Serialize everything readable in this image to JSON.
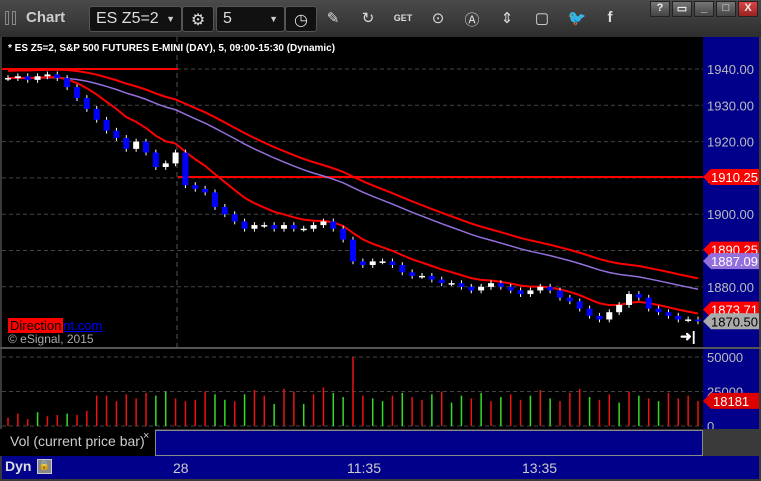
{
  "window": {
    "title": "Chart",
    "symbol": "ES Z5=2",
    "interval": "5",
    "buttons": [
      "?",
      "restore",
      "_",
      "□",
      "X"
    ]
  },
  "toolbar_icons": [
    "settings-icon",
    "clock-icon",
    "pencil-icon",
    "refresh-icon",
    "get-icon",
    "play-icon",
    "alert-icon",
    "link-icon",
    "chat-icon",
    "twitter-icon",
    "facebook-icon"
  ],
  "chart": {
    "header": "* ES Z5=2, S&P 500 FUTURES E-MINI (DAY), 5, 09:00-15:30 (Dynamic)",
    "watermark_label": "Direction",
    "watermark_link": "nt.com",
    "copyright": "© eSignal, 2015",
    "price_ticks": [
      "1940.00",
      "1930.00",
      "1920.00",
      "1910.00",
      "1900.00",
      "1890.00",
      "1880.00"
    ],
    "price_tick_values": [
      1940,
      1930,
      1920,
      1910,
      1900,
      1890,
      1880
    ],
    "price_labels": [
      {
        "text": "1910.25",
        "value": 1910.25,
        "color": "#ff0000"
      },
      {
        "text": "1890.25",
        "value": 1890.25,
        "color": "#ff0000"
      },
      {
        "text": "1887.09",
        "value": 1887.09,
        "color": "#9370db"
      },
      {
        "text": "1873.71",
        "value": 1873.71,
        "color": "#ff0000"
      },
      {
        "text": "1870.50",
        "value": 1870.5,
        "color": "#aaaaaa"
      }
    ],
    "prior_high": 1940,
    "prior_close": 1910.25,
    "open_close": 1937.5,
    "closes": [
      1937.5,
      1938,
      1937,
      1938,
      1938.5,
      1937.5,
      1935,
      1932,
      1929,
      1926,
      1923,
      1921,
      1918,
      1920,
      1917,
      1913,
      1914,
      1917,
      1908,
      1907,
      1906,
      1902,
      1900,
      1898,
      1896,
      1897,
      1897,
      1896,
      1897,
      1896,
      1896,
      1897,
      1898,
      1896,
      1893,
      1887,
      1886,
      1887,
      1887,
      1886,
      1884,
      1883,
      1883,
      1882,
      1881,
      1881,
      1880,
      1879,
      1880,
      1881,
      1880,
      1879,
      1878,
      1879,
      1880,
      1879,
      1877,
      1876,
      1874,
      1872,
      1871,
      1873,
      1875,
      1878,
      1877,
      1874,
      1873,
      1872,
      1871,
      1871,
      1870.5
    ],
    "volume_ticks": [
      "50000",
      "25000",
      "0"
    ],
    "volume_last": "18181",
    "volumes": [
      6000,
      9000,
      5000,
      10000,
      7000,
      8000,
      9000,
      8000,
      11000,
      22000,
      22000,
      18000,
      23000,
      20000,
      24000,
      22000,
      25000,
      20000,
      18000,
      19000,
      25000,
      23000,
      19000,
      18000,
      23000,
      26000,
      22000,
      16000,
      27000,
      25000,
      16000,
      23000,
      28000,
      24000,
      21000,
      50000,
      22000,
      20000,
      18000,
      22000,
      24000,
      21000,
      19000,
      23000,
      25000,
      17000,
      22000,
      20000,
      24000,
      18000,
      21000,
      23000,
      19000,
      22000,
      26000,
      20000,
      18000,
      24000,
      27000,
      21000,
      19000,
      23000,
      17000,
      25000,
      22000,
      20000,
      18000,
      24000,
      20000,
      22000,
      18181
    ],
    "vol_up": [
      false,
      false,
      false,
      true,
      false,
      false,
      true,
      false,
      false,
      false,
      false,
      false,
      false,
      false,
      false,
      true,
      true,
      false,
      false,
      false,
      false,
      true,
      true,
      false,
      true,
      false,
      false,
      true,
      false,
      false,
      true,
      false,
      false,
      true,
      true,
      false,
      false,
      true,
      true,
      false,
      true,
      false,
      false,
      true,
      false,
      true,
      true,
      false,
      true,
      false,
      true,
      false,
      false,
      true,
      false,
      true,
      false,
      false,
      false,
      true,
      false,
      false,
      true,
      false,
      true,
      false,
      true,
      false,
      false,
      false,
      false
    ]
  },
  "legend": {
    "label": "Vol (current price bar)",
    "close": "×"
  },
  "xaxis": {
    "mode": "Dyn",
    "ticks": [
      "28",
      "11:35",
      "13:35"
    ]
  },
  "colors": {
    "down": "#0000ff",
    "up": "#ffffff",
    "red_line": "#ff0000",
    "purple_line": "#9370db",
    "axis_bg": "#00008b",
    "green": "#00ff00"
  }
}
